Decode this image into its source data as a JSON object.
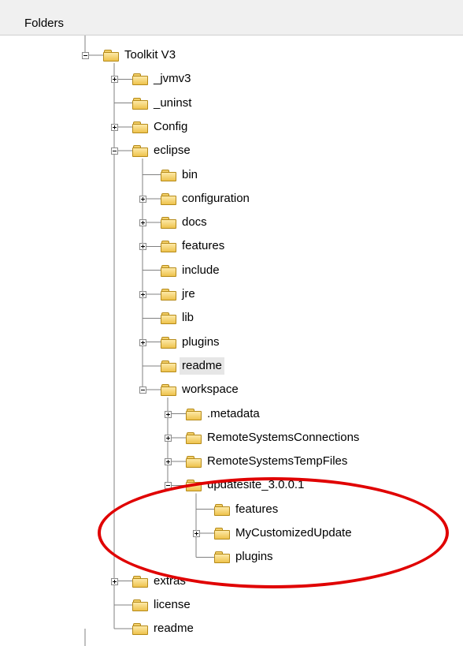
{
  "header": {
    "title": "Folders"
  },
  "tree": {
    "nodes": [
      {
        "label": "Toolkit V3",
        "level": 0,
        "expander": "minus"
      },
      {
        "label": "_jvmv3",
        "level": 1,
        "expander": "plus"
      },
      {
        "label": "_uninst",
        "level": 1,
        "expander": "none"
      },
      {
        "label": "Config",
        "level": 1,
        "expander": "plus"
      },
      {
        "label": "eclipse",
        "level": 1,
        "expander": "minus"
      },
      {
        "label": "bin",
        "level": 2,
        "expander": "none"
      },
      {
        "label": "configuration",
        "level": 2,
        "expander": "plus"
      },
      {
        "label": "docs",
        "level": 2,
        "expander": "plus"
      },
      {
        "label": "features",
        "level": 2,
        "expander": "plus"
      },
      {
        "label": "include",
        "level": 2,
        "expander": "none"
      },
      {
        "label": "jre",
        "level": 2,
        "expander": "plus"
      },
      {
        "label": "lib",
        "level": 2,
        "expander": "none"
      },
      {
        "label": "plugins",
        "level": 2,
        "expander": "plus"
      },
      {
        "label": "readme",
        "level": 2,
        "expander": "none",
        "selected": true
      },
      {
        "label": "workspace",
        "level": 2,
        "expander": "minus"
      },
      {
        "label": ".metadata",
        "level": 3,
        "expander": "plus"
      },
      {
        "label": "RemoteSystemsConnections",
        "level": 3,
        "expander": "plus"
      },
      {
        "label": "RemoteSystemsTempFiles",
        "level": 3,
        "expander": "plus"
      },
      {
        "label": "updatesite_3.0.0.1",
        "level": 3,
        "expander": "minus"
      },
      {
        "label": "features",
        "level": 4,
        "expander": "none"
      },
      {
        "label": "MyCustomizedUpdate",
        "level": 4,
        "expander": "plus"
      },
      {
        "label": "plugins",
        "level": 4,
        "expander": "none"
      },
      {
        "label": "extras",
        "level": 1,
        "expander": "plus"
      },
      {
        "label": "license",
        "level": 1,
        "expander": "none"
      },
      {
        "label": "readme",
        "level": 1,
        "expander": "none"
      }
    ]
  },
  "annotation": {
    "ellipse_color": "#e00000"
  },
  "colors": {
    "folder_fill": "#eec24d",
    "folder_border": "#b58a19",
    "tree_line": "#808080"
  },
  "icons": {
    "folder": "folder-icon",
    "expand": "plus-box-icon",
    "collapse": "minus-box-icon"
  }
}
